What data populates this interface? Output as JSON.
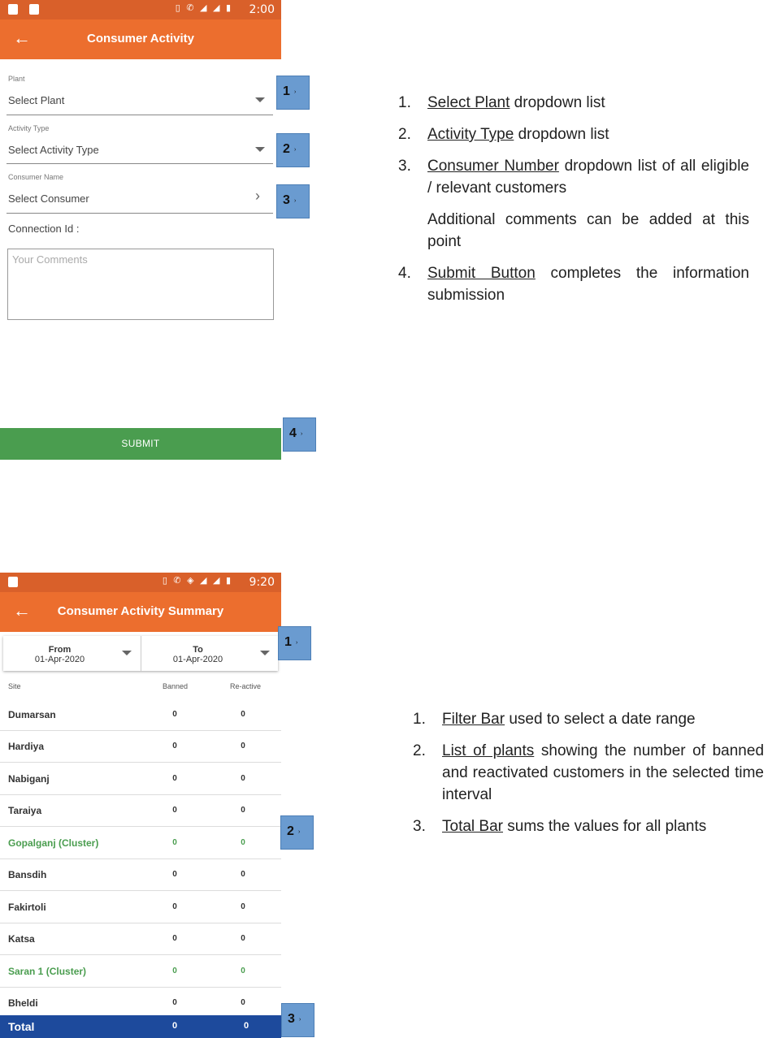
{
  "screen1": {
    "status_time": "2:00",
    "title": "Consumer Activity",
    "plant": {
      "label": "Plant",
      "value": "Select Plant"
    },
    "activity": {
      "label": "Activity Type",
      "value": "Select Activity Type"
    },
    "consumer": {
      "label": "Consumer Name",
      "value": "Select Consumer"
    },
    "connection_label": "Connection Id :",
    "comments_placeholder": "Your Comments",
    "submit_label": "SUBMIT",
    "badges": [
      "1",
      "2",
      "3",
      "4"
    ]
  },
  "desc1": {
    "items": [
      {
        "num": "1.",
        "link": "Select Plant",
        "text": " dropdown list"
      },
      {
        "num": "2.",
        "link": "Activity Type",
        "text": " dropdown list"
      },
      {
        "num": "3.",
        "link": "Consumer Number",
        "text": " dropdown list of all eligible / relevant customers"
      },
      {
        "num": "",
        "link": "",
        "text": "Additional comments can be added at this point"
      },
      {
        "num": "4.",
        "link": "Submit Button",
        "text": " completes the information submission"
      }
    ]
  },
  "screen2": {
    "status_time": "9:20",
    "title": "Consumer Activity Summary",
    "from": {
      "label": "From",
      "value": "01-Apr-2020"
    },
    "to": {
      "label": "To",
      "value": "01-Apr-2020"
    },
    "columns": {
      "site": "Site",
      "banned": "Banned",
      "reactive": "Re-active"
    },
    "rows": [
      {
        "site": "Dumarsan",
        "banned": "0",
        "reactive": "0"
      },
      {
        "site": "Hardiya",
        "banned": "0",
        "reactive": "0"
      },
      {
        "site": "Nabiganj",
        "banned": "0",
        "reactive": "0"
      },
      {
        "site": "Taraiya",
        "banned": "0",
        "reactive": "0"
      },
      {
        "site": "Gopalganj (Cluster)",
        "banned": "0",
        "reactive": "0"
      },
      {
        "site": "Bansdih",
        "banned": "0",
        "reactive": "0"
      },
      {
        "site": "Fakirtoli",
        "banned": "0",
        "reactive": "0"
      },
      {
        "site": "Katsa",
        "banned": "0",
        "reactive": "0"
      },
      {
        "site": "Saran 1 (Cluster)",
        "banned": "0",
        "reactive": "0"
      },
      {
        "site": "Bheldi",
        "banned": "0",
        "reactive": "0"
      }
    ],
    "total": {
      "label": "Total",
      "banned": "0",
      "reactive": "0"
    },
    "badges": [
      "1",
      "2",
      "3"
    ]
  },
  "desc2": {
    "items": [
      {
        "num": "1.",
        "link": "Filter Bar",
        "text": " used to select a date range"
      },
      {
        "num": "2.",
        "link": "List of plants",
        "text": " showing the number of banned and reactivated customers in the selected time interval"
      },
      {
        "num": "3.",
        "link": "Total Bar",
        "text": " sums the values for all plants"
      }
    ]
  },
  "colors": {
    "appbar": "#ec6e2e",
    "statusbar": "#d9602a",
    "submit": "#4a9d4f",
    "cluster_text": "#4a9d4f",
    "total_bar": "#1d4a9c",
    "badge": "#6a9bd0"
  }
}
